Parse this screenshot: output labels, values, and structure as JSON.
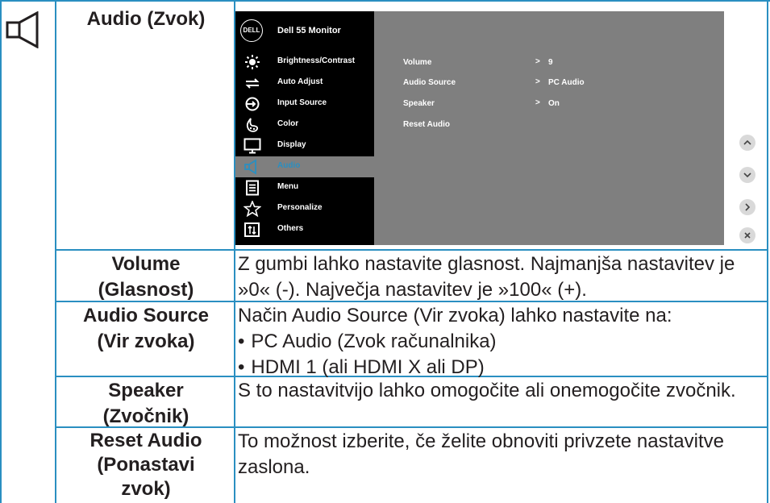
{
  "header": {
    "title": "Audio (Zvok)"
  },
  "osd": {
    "brand": "DELL",
    "title": "Dell 55 Monitor",
    "menu": [
      {
        "label": "Brightness/Contrast",
        "icon": "brightness-icon"
      },
      {
        "label": "Auto Adjust",
        "icon": "auto-adjust-icon"
      },
      {
        "label": "Input Source",
        "icon": "input-source-icon"
      },
      {
        "label": "Color",
        "icon": "color-icon"
      },
      {
        "label": "Display",
        "icon": "display-icon"
      },
      {
        "label": "Audio",
        "icon": "speaker-icon",
        "active": true
      },
      {
        "label": "Menu",
        "icon": "menu-icon"
      },
      {
        "label": "Personalize",
        "icon": "star-icon"
      },
      {
        "label": "Others",
        "icon": "others-icon"
      }
    ],
    "settings": [
      {
        "label": "Volume",
        "value": "9"
      },
      {
        "label": "Audio Source",
        "value": "PC Audio"
      },
      {
        "label": "Speaker",
        "value": "On"
      },
      {
        "label": "Reset Audio",
        "value": ""
      }
    ],
    "accent": "#2a8fc1"
  },
  "rows": [
    {
      "label_lines": [
        "Volume",
        "(Glasnost)"
      ],
      "desc_lines": [
        "Z gumbi lahko nastavite glasnost. Najmanjša nastavitev je",
        "»0« (-). Največja nastavitev je »100« (+)."
      ]
    },
    {
      "label_lines": [
        "Audio Source",
        "(Vir zvoka)"
      ],
      "desc_lines": [
        "Način Audio Source (Vir zvoka) lahko nastavite na:"
      ],
      "bullets": [
        "PC Audio (Zvok računalnika)",
        "HDMI 1 (ali HDMI X ali DP)"
      ]
    },
    {
      "label_lines": [
        "Speaker",
        "(Zvočnik)"
      ],
      "desc_lines": [
        "S to nastavitvijo lahko omogočite ali onemogočite zvočnik."
      ]
    },
    {
      "label_lines": [
        "Reset Audio",
        "(Ponastavi",
        "zvok)"
      ],
      "desc_lines": [
        "To možnost izberite, če želite obnoviti privzete nastavitve",
        "zaslona."
      ]
    }
  ]
}
